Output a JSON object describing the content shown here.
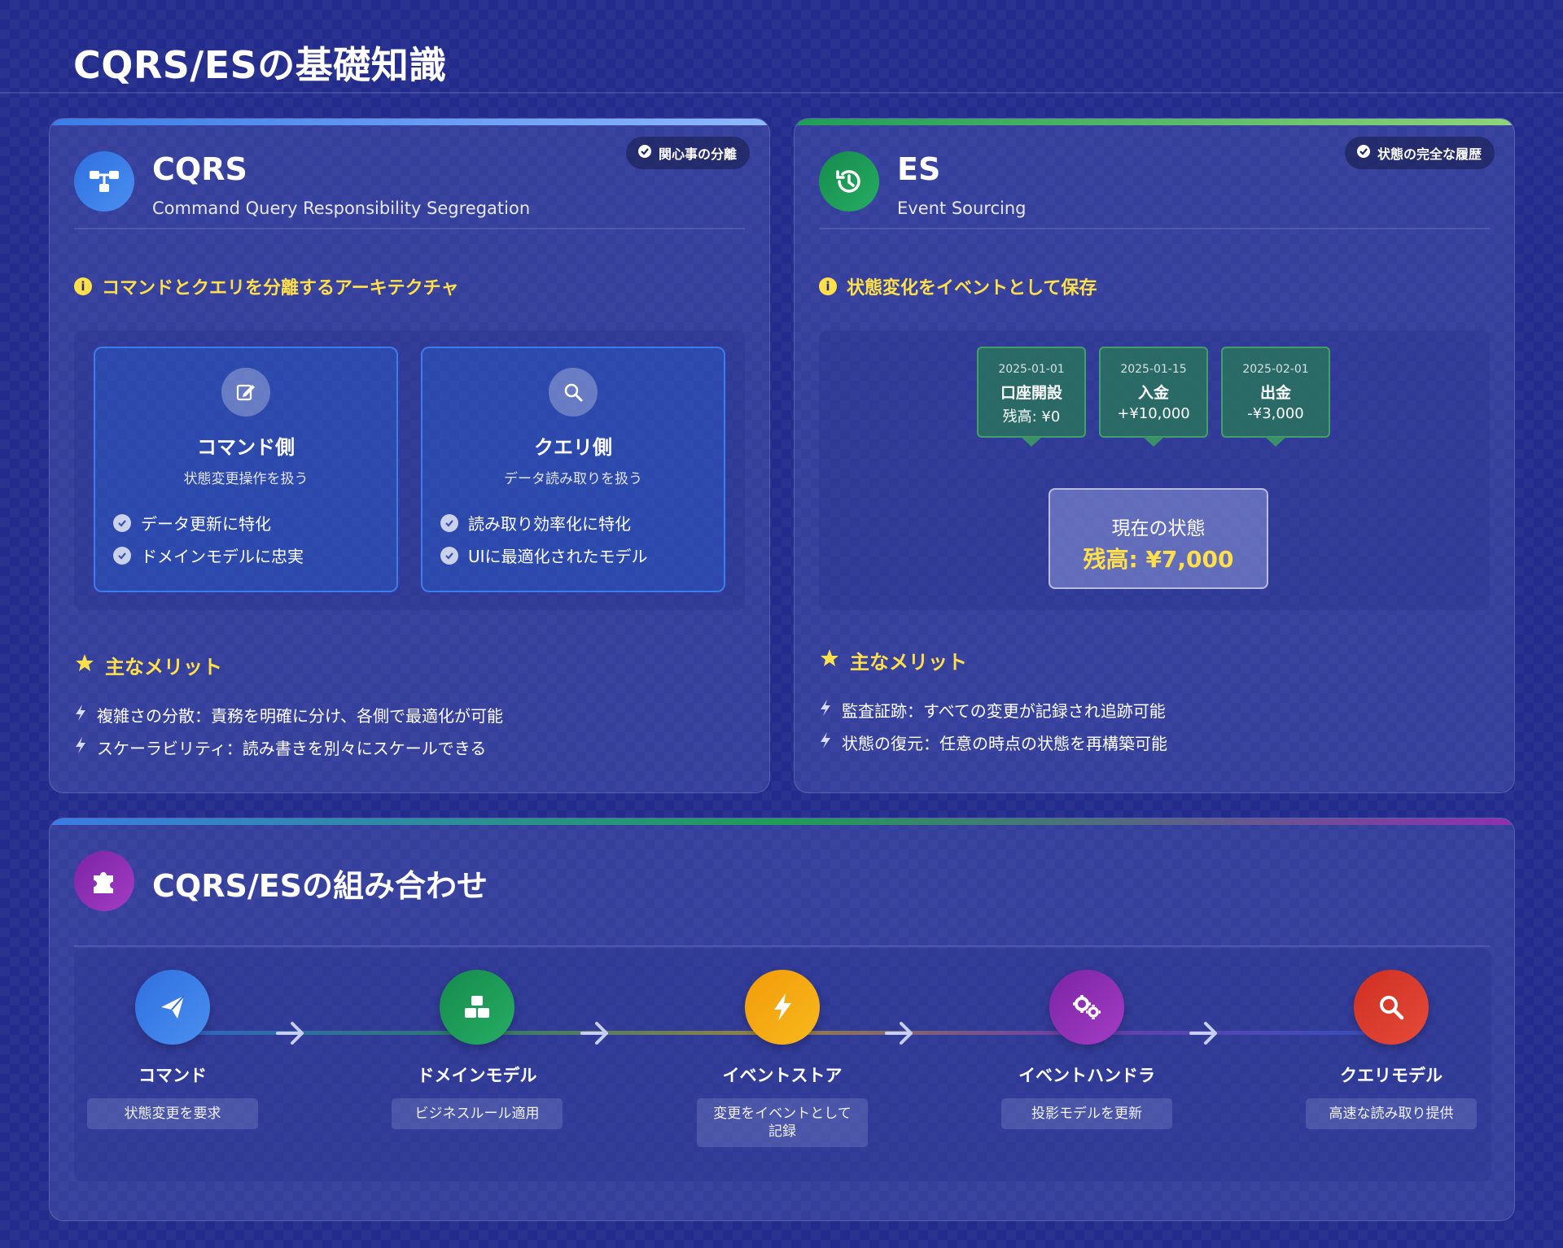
{
  "page": {
    "title": "CQRS/ESの基礎知識"
  },
  "colors": {
    "cqrs_accent": "#3b7ce6",
    "es_accent": "#1f9d58",
    "combo_accent": "#8e2fb0",
    "highlight": "#ffe04a"
  },
  "cqrs": {
    "title": "CQRS",
    "subtitle": "Command Query Responsibility Segregation",
    "badge": "関心事の分離",
    "badge_icon": "check-circle-icon",
    "icon": "sitemap-icon",
    "info": "コマンドとクエリを分離するアーキテクチャ",
    "command_side": {
      "icon": "edit-icon",
      "title": "コマンド側",
      "subtitle": "状態変更操作を扱う",
      "points": [
        "データ更新に特化",
        "ドメインモデルに忠実"
      ]
    },
    "query_side": {
      "icon": "search-icon",
      "title": "クエリ側",
      "subtitle": "データ読み取りを扱う",
      "points": [
        "読み取り効率化に特化",
        "UIに最適化されたモデル"
      ]
    },
    "merits_title": "主なメリット",
    "merits": [
      "複雑さの分散：責務を明確に分け、各側で最適化が可能",
      "スケーラビリティ：読み書きを別々にスケールできる"
    ]
  },
  "es": {
    "title": "ES",
    "subtitle": "Event Sourcing",
    "badge": "状態の完全な履歴",
    "badge_icon": "check-circle-icon",
    "icon": "history-icon",
    "info": "状態変化をイベントとして保存",
    "events": [
      {
        "date": "2025-01-01",
        "name": "口座開設",
        "amount": "残高: ¥0"
      },
      {
        "date": "2025-01-15",
        "name": "入金",
        "amount": "+¥10,000"
      },
      {
        "date": "2025-02-01",
        "name": "出金",
        "amount": "-¥3,000"
      }
    ],
    "state_label": "現在の状態",
    "state_value": "残高: ¥7,000",
    "merits_title": "主なメリット",
    "merits": [
      "監査証跡：すべての変更が記録され追跡可能",
      "状態の復元：任意の時点の状態を再構築可能"
    ]
  },
  "combo": {
    "title": "CQRS/ESの組み合わせ",
    "icon": "puzzle-icon",
    "steps": [
      {
        "name": "コマンド",
        "desc": "状態変更を要求",
        "icon": "paper-plane-icon",
        "color": "#3b7ce6"
      },
      {
        "name": "ドメインモデル",
        "desc": "ビジネスルール適用",
        "icon": "cubes-icon",
        "color": "#1f9d58"
      },
      {
        "name": "イベントストア",
        "desc": "変更をイベントとして記録",
        "icon": "bolt-icon",
        "color": "#f5a70f"
      },
      {
        "name": "イベントハンドラ",
        "desc": "投影モデルを更新",
        "icon": "cogs-icon",
        "color": "#8e2fb0"
      },
      {
        "name": "クエリモデル",
        "desc": "高速な読み取り提供",
        "icon": "search-icon",
        "color": "#d83a2c"
      }
    ]
  }
}
